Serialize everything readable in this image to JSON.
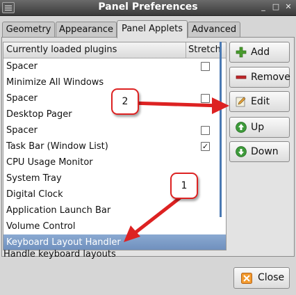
{
  "window": {
    "title": "Panel Preferences"
  },
  "titlebar_buttons": {
    "minimize": "_",
    "maximize": "□",
    "close": "✕"
  },
  "tabs": [
    {
      "label": "Geometry"
    },
    {
      "label": "Appearance"
    },
    {
      "label": "Panel Applets"
    },
    {
      "label": "Advanced"
    }
  ],
  "active_tab": "Panel Applets",
  "list": {
    "columns": {
      "plugins": "Currently loaded plugins",
      "stretch": "Stretch"
    },
    "rows": [
      {
        "name": "Spacer",
        "stretch": false,
        "has_checkbox": true
      },
      {
        "name": "Minimize All Windows",
        "has_checkbox": false
      },
      {
        "name": "Spacer",
        "stretch": false,
        "has_checkbox": true
      },
      {
        "name": "Desktop Pager",
        "has_checkbox": false
      },
      {
        "name": "Spacer",
        "stretch": false,
        "has_checkbox": true
      },
      {
        "name": "Task Bar (Window List)",
        "stretch": true,
        "has_checkbox": true
      },
      {
        "name": "CPU Usage Monitor",
        "has_checkbox": false
      },
      {
        "name": "System Tray",
        "has_checkbox": false
      },
      {
        "name": "Digital Clock",
        "has_checkbox": false
      },
      {
        "name": "Application Launch Bar",
        "has_checkbox": false
      },
      {
        "name": "Volume Control",
        "has_checkbox": false
      },
      {
        "name": "Keyboard Layout Handler",
        "has_checkbox": false,
        "selected": true
      }
    ],
    "status": "Handle keyboard layouts"
  },
  "buttons": {
    "add": "Add",
    "remove": "Remove",
    "edit": "Edit",
    "up": "Up",
    "down": "Down",
    "close": "Close"
  },
  "annotations": {
    "callout_1": "1",
    "callout_2": "2",
    "color": "#d22222"
  },
  "colors": {
    "selection": "#7a98c4",
    "titlebar": "#4a4a4a"
  }
}
